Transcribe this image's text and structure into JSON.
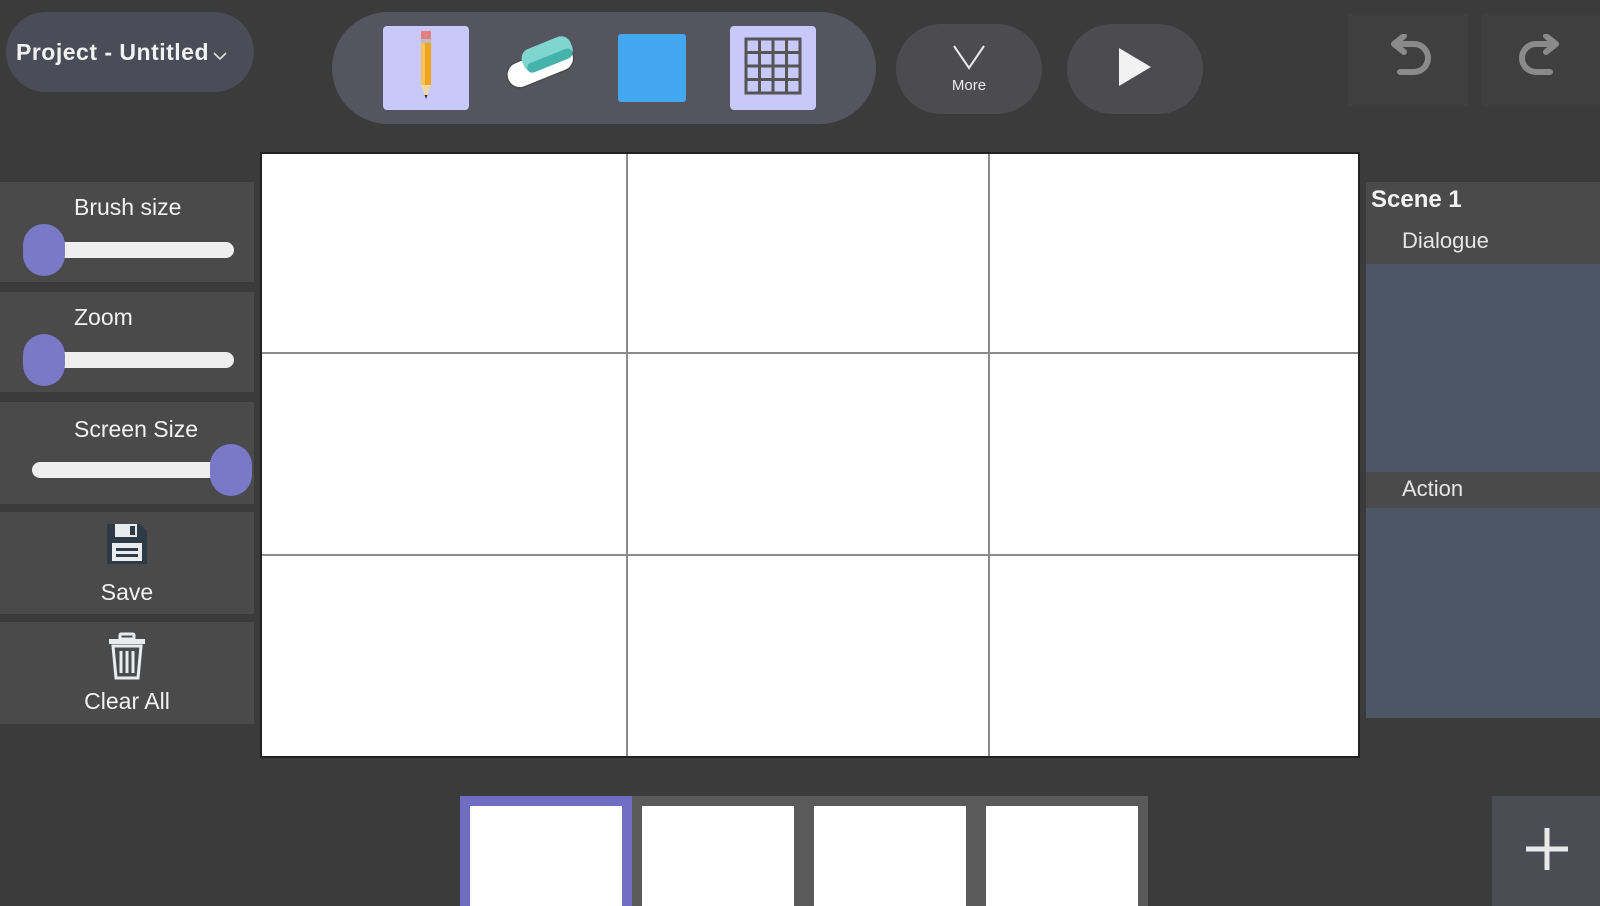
{
  "project": {
    "title": "Project - Untitled",
    "dropdown_icon": "chevron-down-icon"
  },
  "toolbar": {
    "tools": [
      {
        "name": "pencil",
        "icon": "pencil-icon",
        "selected": true
      },
      {
        "name": "eraser",
        "icon": "eraser-icon",
        "selected": false
      },
      {
        "name": "color",
        "icon": "color-swatch",
        "color": "#43a7ef"
      },
      {
        "name": "grid",
        "icon": "grid-icon",
        "selected": true
      }
    ],
    "more_label": "More",
    "play_icon": "play-icon",
    "undo_icon": "undo-icon",
    "redo_icon": "redo-icon"
  },
  "left_panel": {
    "brush_size_label": "Brush size",
    "brush_size_value": 0.0,
    "zoom_label": "Zoom",
    "zoom_value": 0.0,
    "screen_size_label": "Screen Size",
    "screen_size_value": 1.0,
    "save_label": "Save",
    "clear_all_label": "Clear All"
  },
  "scene": {
    "title": "Scene 1",
    "dialogue_label": "Dialogue",
    "dialogue_text": "",
    "action_label": "Action",
    "action_text": ""
  },
  "frames": {
    "count": 4,
    "selected_index": 0,
    "add_icon": "plus-icon"
  },
  "colors": {
    "accent": "#7a79c7",
    "selected_tool_bg": "#c9c8fb",
    "brush_color": "#43a7ef",
    "scene_box": "#4b5764"
  }
}
